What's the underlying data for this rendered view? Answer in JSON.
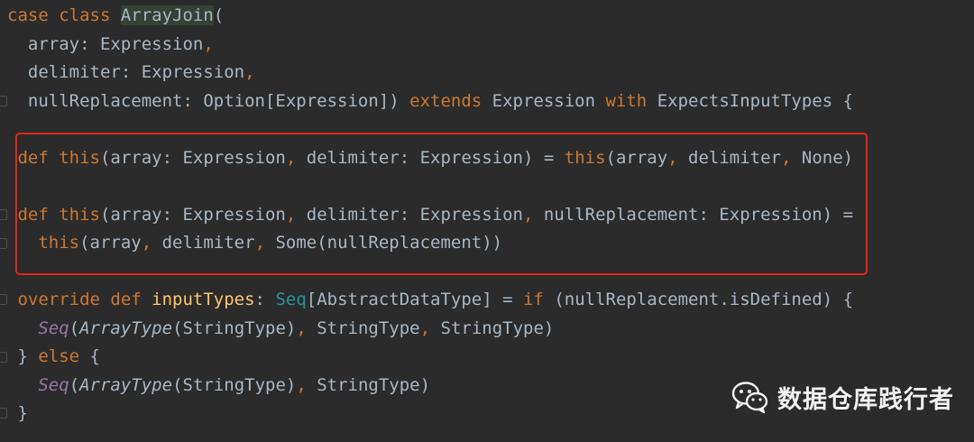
{
  "editor": {
    "lines": [
      [
        {
          "t": "case class ",
          "c": "kw"
        },
        {
          "t": "ArrayJoin",
          "c": "hl"
        },
        {
          "t": "(",
          "c": "plain"
        }
      ],
      [
        {
          "t": "  array: Expression",
          "c": "plain"
        },
        {
          "t": ",",
          "c": "kw"
        }
      ],
      [
        {
          "t": "  delimiter: Expression",
          "c": "plain"
        },
        {
          "t": ",",
          "c": "kw"
        }
      ],
      [
        {
          "t": "  nullReplacement: Option[Expression]) ",
          "c": "plain"
        },
        {
          "t": "extends ",
          "c": "kw"
        },
        {
          "t": "Expression ",
          "c": "plain"
        },
        {
          "t": "with ",
          "c": "kw"
        },
        {
          "t": "ExpectsInputTypes {",
          "c": "plain"
        }
      ],
      [],
      [
        {
          "t": " def ",
          "c": "kw"
        },
        {
          "t": "this",
          "c": "kw"
        },
        {
          "t": "(array: Expression",
          "c": "plain"
        },
        {
          "t": ", ",
          "c": "kw"
        },
        {
          "t": "delimiter: Expression) = ",
          "c": "plain"
        },
        {
          "t": "this",
          "c": "kw"
        },
        {
          "t": "(array",
          "c": "plain"
        },
        {
          "t": ", ",
          "c": "kw"
        },
        {
          "t": "delimiter",
          "c": "plain"
        },
        {
          "t": ", ",
          "c": "kw"
        },
        {
          "t": "None)",
          "c": "plain"
        }
      ],
      [],
      [
        {
          "t": " def ",
          "c": "kw"
        },
        {
          "t": "this",
          "c": "kw"
        },
        {
          "t": "(array: Expression",
          "c": "plain"
        },
        {
          "t": ", ",
          "c": "kw"
        },
        {
          "t": "delimiter: Expression",
          "c": "plain"
        },
        {
          "t": ", ",
          "c": "kw"
        },
        {
          "t": "nullReplacement: Expression) =",
          "c": "plain"
        }
      ],
      [
        {
          "t": "   this",
          "c": "kw"
        },
        {
          "t": "(array",
          "c": "plain"
        },
        {
          "t": ", ",
          "c": "kw"
        },
        {
          "t": "delimiter",
          "c": "plain"
        },
        {
          "t": ", ",
          "c": "kw"
        },
        {
          "t": "Some(nullReplacement))",
          "c": "plain"
        }
      ],
      [],
      [
        {
          "t": " override def ",
          "c": "kw"
        },
        {
          "t": "inputTypes",
          "c": "fn"
        },
        {
          "t": ": ",
          "c": "plain"
        },
        {
          "t": "Seq",
          "c": "typ"
        },
        {
          "t": "[AbstractDataType] = ",
          "c": "plain"
        },
        {
          "t": "if ",
          "c": "kw"
        },
        {
          "t": "(nullReplacement.isDefined) {",
          "c": "plain"
        }
      ],
      [
        {
          "t": "   ",
          "c": "plain"
        },
        {
          "t": "Seq",
          "c": "seq"
        },
        {
          "t": "(",
          "c": "plain"
        },
        {
          "t": "ArrayType",
          "c": "ctor"
        },
        {
          "t": "(StringType)",
          "c": "plain"
        },
        {
          "t": ", ",
          "c": "kw"
        },
        {
          "t": "StringType",
          "c": "plain"
        },
        {
          "t": ", ",
          "c": "kw"
        },
        {
          "t": "StringType)",
          "c": "plain"
        }
      ],
      [
        {
          "t": " } ",
          "c": "plain"
        },
        {
          "t": "else ",
          "c": "kw"
        },
        {
          "t": "{",
          "c": "plain"
        }
      ],
      [
        {
          "t": "   ",
          "c": "plain"
        },
        {
          "t": "Seq",
          "c": "seq"
        },
        {
          "t": "(",
          "c": "plain"
        },
        {
          "t": "ArrayType",
          "c": "ctor"
        },
        {
          "t": "(StringType)",
          "c": "plain"
        },
        {
          "t": ", ",
          "c": "kw"
        },
        {
          "t": "StringType)",
          "c": "plain"
        }
      ],
      [
        {
          "t": " }",
          "c": "plain"
        }
      ]
    ]
  },
  "watermark": {
    "text": "数据仓库践行者",
    "icon": "wechat-icon"
  },
  "colors": {
    "keyword": "#cc7832",
    "text": "#a9b7c6",
    "method": "#ffc66d",
    "type": "#20999d",
    "highlight_box": "#e0261b",
    "background": "#2b2b2b"
  }
}
